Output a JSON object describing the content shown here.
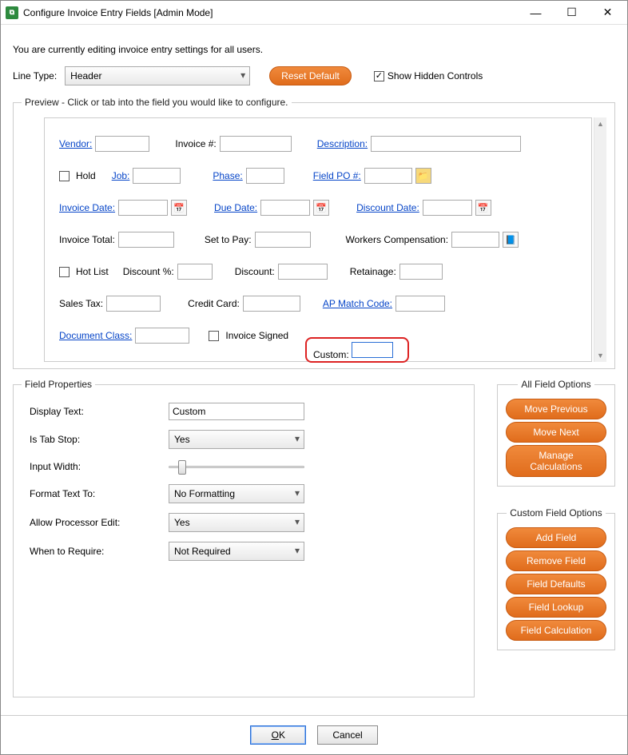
{
  "window": {
    "title": "Configure Invoice Entry Fields [Admin Mode]",
    "subtitle": "You are currently editing invoice entry settings for all users."
  },
  "toprow": {
    "lineTypeLabel": "Line Type:",
    "lineTypeValue": "Header",
    "resetDefault": "Reset Default",
    "showHidden": "Show Hidden Controls",
    "showHiddenChecked": true
  },
  "preview": {
    "legend": "Preview - Click or tab into the field you would like to configure.",
    "fields": {
      "vendor": "Vendor:",
      "invoiceNum": "Invoice #:",
      "description": "Description:",
      "hold": "Hold",
      "job": "Job:",
      "phase": "Phase:",
      "fieldPO": "Field PO #:",
      "invoiceDate": "Invoice Date:",
      "dueDate": "Due Date:",
      "discountDate": "Discount Date:",
      "invoiceTotal": "Invoice Total:",
      "setToPay": "Set to Pay:",
      "workersComp": "Workers Compensation:",
      "hotList": "Hot List",
      "discountPct": "Discount %:",
      "discount": "Discount:",
      "retainage": "Retainage:",
      "salesTax": "Sales Tax:",
      "creditCard": "Credit Card:",
      "apMatch": "AP Match Code:",
      "documentClass": "Document Class:",
      "invoiceSigned": "Invoice Signed",
      "custom": "Custom:"
    }
  },
  "fieldProps": {
    "legend": "Field Properties",
    "displayTextLabel": "Display Text:",
    "displayTextValue": "Custom",
    "isTabStopLabel": "Is Tab Stop:",
    "isTabStopValue": "Yes",
    "inputWidthLabel": "Input Width:",
    "formatLabel": "Format Text To:",
    "formatValue": "No Formatting",
    "allowEditLabel": "Allow Processor Edit:",
    "allowEditValue": "Yes",
    "whenRequireLabel": "When to Require:",
    "whenRequireValue": "Not Required"
  },
  "allFieldOptions": {
    "legend": "All Field Options",
    "movePrevious": "Move Previous",
    "moveNext": "Move Next",
    "manageCalc": "Manage Calculations"
  },
  "customFieldOptions": {
    "legend": "Custom Field Options",
    "addField": "Add Field",
    "removeField": "Remove Field",
    "fieldDefaults": "Field Defaults",
    "fieldLookup": "Field Lookup",
    "fieldCalc": "Field Calculation"
  },
  "footer": {
    "ok": "OK",
    "cancel": "Cancel"
  }
}
